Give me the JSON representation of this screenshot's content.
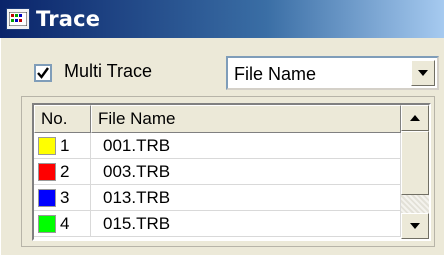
{
  "window": {
    "title": "Trace",
    "icon": "trace-app-icon"
  },
  "controls": {
    "multi_trace_label": "Multi Trace",
    "multi_trace_checked": true,
    "sort_dropdown_value": "File Name"
  },
  "table": {
    "columns": [
      "No.",
      "File Name"
    ],
    "rows": [
      {
        "no": "1",
        "color": "#ffff00",
        "file": "001.TRB"
      },
      {
        "no": "2",
        "color": "#ff0000",
        "file": "003.TRB"
      },
      {
        "no": "3",
        "color": "#0000ff",
        "file": "013.TRB"
      },
      {
        "no": "4",
        "color": "#00ff00",
        "file": "015.TRB"
      }
    ]
  }
}
